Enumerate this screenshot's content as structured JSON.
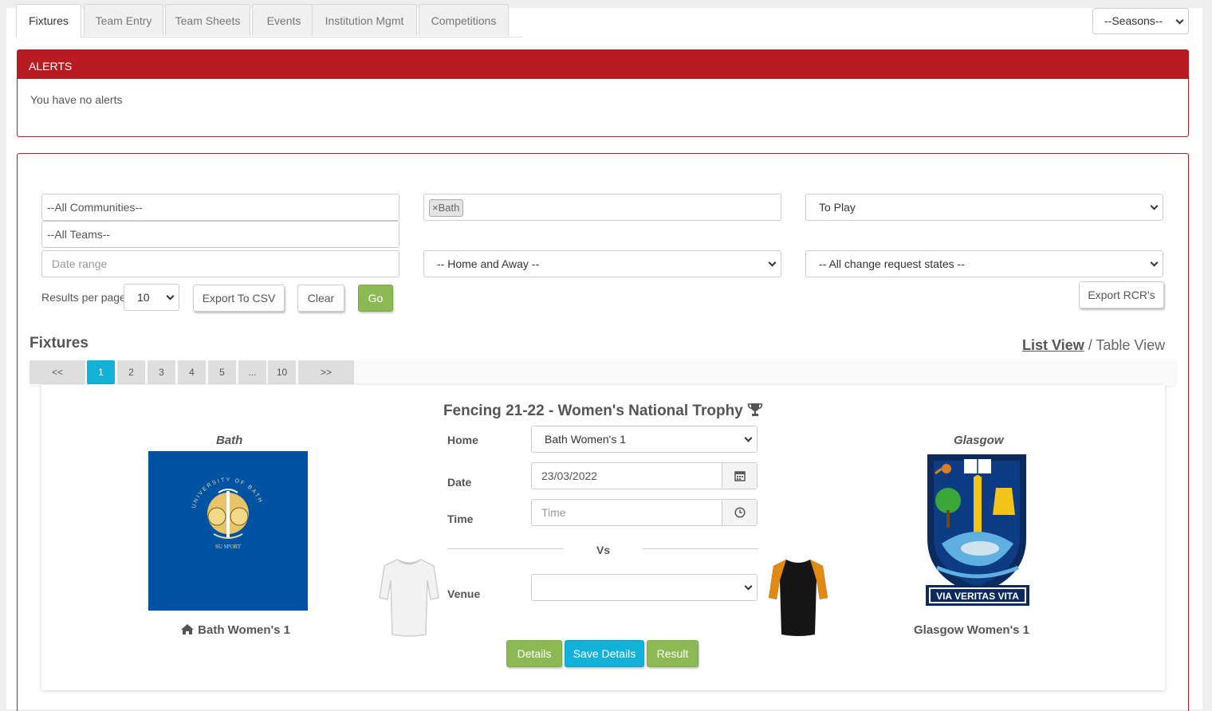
{
  "tabs": [
    "Fixtures",
    "Team Entry",
    "Team Sheets",
    "Events",
    "Institution Mgmt",
    "Competitions"
  ],
  "seasons": "--Seasons--",
  "alerts": {
    "title": "ALERTS",
    "message": "You have no alerts"
  },
  "filters": {
    "communities": "--All Communities--",
    "teams": "--All Teams--",
    "date_range_placeholder": "Date range",
    "institution_tag": "Bath",
    "home_away": "-- Home and Away --",
    "status": "To Play",
    "change_requests": "-- All change request states --",
    "results_per_page_label": "Results per page",
    "results_per_page": "10",
    "export_csv": "Export To CSV",
    "clear": "Clear",
    "go": "Go",
    "export_rcr": "Export RCR's"
  },
  "fixtures_title": "Fixtures",
  "views": {
    "list": "List View",
    "separator": " / ",
    "table": "Table View"
  },
  "pagination": [
    "<<",
    "1",
    "2",
    "3",
    "4",
    "5",
    "...",
    "10",
    ">>"
  ],
  "pagination_active": "1",
  "fixture": {
    "title": "Fencing 21-22 - Women's National Trophy",
    "home_institution": "Bath",
    "home_team": "Bath Women's 1",
    "away_institution": "Glasgow",
    "away_team": "Glasgow Women's 1",
    "home_label": "Home",
    "home_value": "Bath Women's 1",
    "date_label": "Date",
    "date_value": "23/03/2022",
    "time_label": "Time",
    "time_placeholder": "Time",
    "vs": "Vs",
    "venue_label": "Venue",
    "venue_value": "",
    "crest_text_home": "UNIVERSITY OF BATH",
    "crest_sub_home": "SU SPORT",
    "crest_motto_away": "VIA VERITAS VITA",
    "buttons": {
      "details": "Details",
      "save": "Save Details",
      "result": "Result"
    }
  },
  "colors": {
    "brand_red": "#b81c22",
    "green": "#8db955",
    "blue": "#12b1d8",
    "bath_blue": "#0052a2",
    "glasgow_navy": "#0b2b5e"
  }
}
